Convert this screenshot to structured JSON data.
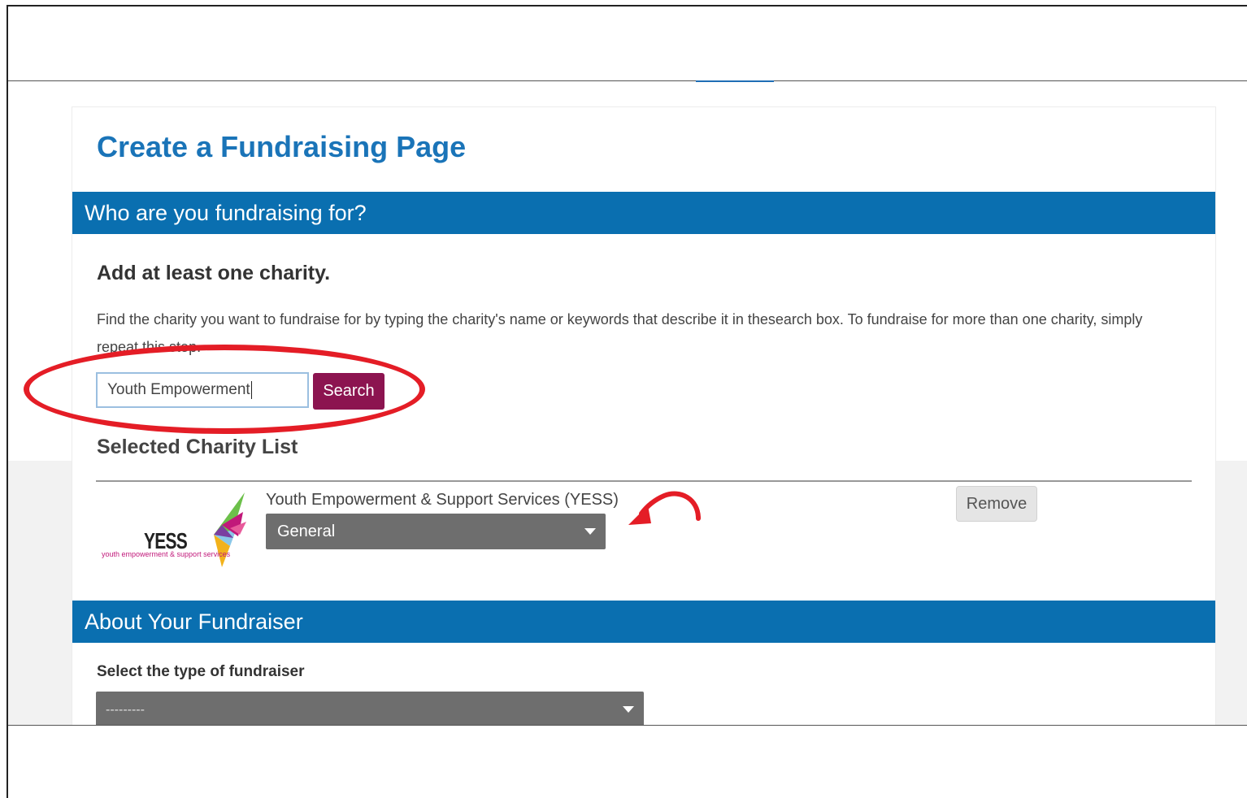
{
  "page": {
    "title": "Create a Fundraising Page"
  },
  "section_charity": {
    "header": "Who are you fundraising for?",
    "subheading": "Add at least one charity.",
    "instructions": "Find the charity you want to fundraise for by typing the charity's name or keywords that describe it in thesearch box. To fundraise for more than one charity, simply repeat this step."
  },
  "search": {
    "value": "Youth Empowerment",
    "button_label": "Search"
  },
  "selected_list": {
    "heading": "Selected Charity List",
    "items": [
      {
        "name": "Youth Empowerment & Support Services (YESS)",
        "logo_text": "YESS",
        "logo_tagline": "youth empowerment & support services",
        "fund_selected": "General",
        "remove_label": "Remove"
      }
    ]
  },
  "section_about": {
    "header": "About Your Fundraiser",
    "type_label": "Select the type of fundraiser",
    "type_selected": "---------"
  },
  "colors": {
    "primary_blue": "#0a6fb0",
    "title_blue": "#1a74b8",
    "search_button": "#8c1450",
    "annotation_red": "#e41d26",
    "select_grey": "#6e6e6e"
  }
}
